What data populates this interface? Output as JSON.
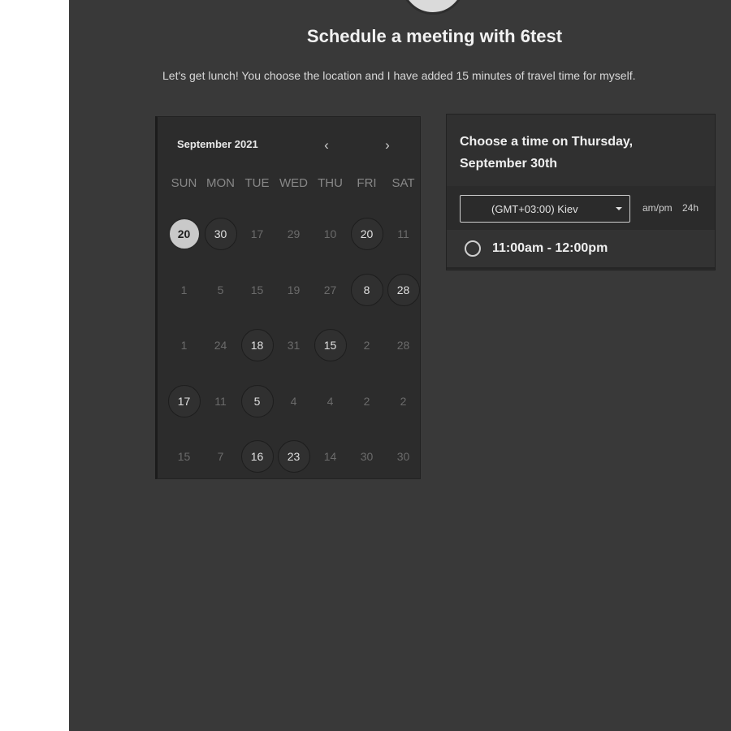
{
  "page": {
    "title": "Schedule a meeting with 6test",
    "description": "Let's get lunch! You choose the location and I have added 15 minutes of travel time for myself."
  },
  "calendar": {
    "month_label": "September 2021",
    "prev_icon": "chevron-left-icon",
    "next_icon": "chevron-right-icon",
    "weekdays": [
      "SUN",
      "MON",
      "TUE",
      "WED",
      "THU",
      "FRI",
      "SAT"
    ],
    "weeks": [
      [
        {
          "d": "20",
          "s": "selected"
        },
        {
          "d": "30",
          "s": "available"
        },
        {
          "d": "17",
          "s": "muted"
        },
        {
          "d": "29",
          "s": "muted"
        },
        {
          "d": "10",
          "s": "muted"
        },
        {
          "d": "20",
          "s": "available"
        },
        {
          "d": "11",
          "s": "muted"
        }
      ],
      [
        {
          "d": "1",
          "s": "muted"
        },
        {
          "d": "5",
          "s": "muted"
        },
        {
          "d": "15",
          "s": "muted"
        },
        {
          "d": "19",
          "s": "muted"
        },
        {
          "d": "27",
          "s": "muted"
        },
        {
          "d": "8",
          "s": "available"
        },
        {
          "d": "28",
          "s": "available"
        }
      ],
      [
        {
          "d": "1",
          "s": "muted"
        },
        {
          "d": "24",
          "s": "muted"
        },
        {
          "d": "18",
          "s": "available"
        },
        {
          "d": "31",
          "s": "muted"
        },
        {
          "d": "15",
          "s": "available"
        },
        {
          "d": "2",
          "s": "muted"
        },
        {
          "d": "28",
          "s": "muted"
        }
      ],
      [
        {
          "d": "17",
          "s": "available"
        },
        {
          "d": "11",
          "s": "muted"
        },
        {
          "d": "5",
          "s": "available"
        },
        {
          "d": "4",
          "s": "muted"
        },
        {
          "d": "4",
          "s": "muted"
        },
        {
          "d": "2",
          "s": "muted"
        },
        {
          "d": "2",
          "s": "muted"
        }
      ],
      [
        {
          "d": "15",
          "s": "muted"
        },
        {
          "d": "7",
          "s": "muted"
        },
        {
          "d": "16",
          "s": "available"
        },
        {
          "d": "23",
          "s": "available"
        },
        {
          "d": "14",
          "s": "muted"
        },
        {
          "d": "30",
          "s": "muted"
        },
        {
          "d": "30",
          "s": "muted"
        }
      ]
    ]
  },
  "time_panel": {
    "heading": "Choose a time on Thursday, September 30th",
    "timezone": "(GMT+03:00) Kiev",
    "format_12": "am/pm",
    "format_24": "24h",
    "slots": [
      "11:00am - 12:00pm"
    ]
  },
  "colors": {
    "background": "#393939",
    "panel": "#2c2c2c",
    "selected_day": "#c9c9c9"
  }
}
